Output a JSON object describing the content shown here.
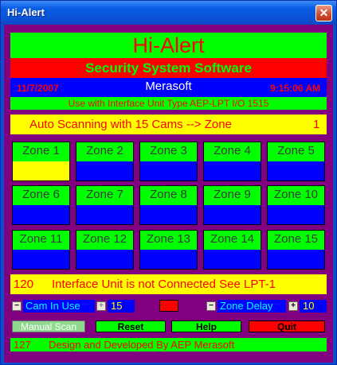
{
  "window": {
    "title": "Hi-Alert",
    "close_glyph": "✕"
  },
  "header": {
    "app_name": "Hi-Alert",
    "subtitle": "Security System Software",
    "date": "11/7/2007",
    "company": "Merasoft",
    "time": "9:15:06 AM",
    "interface_note": "Use with Interface Unit Type AEP-LPT I/O 1515"
  },
  "scan": {
    "text": "Auto Scanning with 15 Cams -->  Zone",
    "zone": "1"
  },
  "zones": [
    {
      "label": "Zone 1",
      "active": true
    },
    {
      "label": "Zone 2",
      "active": false
    },
    {
      "label": "Zone 3",
      "active": false
    },
    {
      "label": "Zone 4",
      "active": false
    },
    {
      "label": "Zone 5",
      "active": false
    },
    {
      "label": "Zone 6",
      "active": false
    },
    {
      "label": "Zone 7",
      "active": false
    },
    {
      "label": "Zone 8",
      "active": false
    },
    {
      "label": "Zone 9",
      "active": false
    },
    {
      "label": "Zone 10",
      "active": false
    },
    {
      "label": "Zone 11",
      "active": false
    },
    {
      "label": "Zone 12",
      "active": false
    },
    {
      "label": "Zone 13",
      "active": false
    },
    {
      "label": "Zone 14",
      "active": false
    },
    {
      "label": "Zone 15",
      "active": false
    }
  ],
  "status": {
    "code": "120",
    "message": "Interface Unit is not Connected See LPT-1"
  },
  "controls": {
    "cam_minus": "−",
    "cam_label": "Cam In Use",
    "cam_plus": "+",
    "cam_value": "15",
    "delay_minus": "−",
    "delay_label": "Zone Delay",
    "delay_plus": "+",
    "delay_value": "10"
  },
  "buttons": {
    "manual_scan": "Manual Scan",
    "reset": "Reset",
    "help": "Help",
    "quit": "Quit"
  },
  "footer": {
    "code": "127",
    "message": "Design and Developed By AEP Merasoft"
  },
  "colors": {
    "background": "#800080",
    "zone_label": "#00ff00",
    "zone_active": "#ffff00",
    "zone_idle": "#0000ff",
    "alarm_indicator": "#ff0000"
  }
}
